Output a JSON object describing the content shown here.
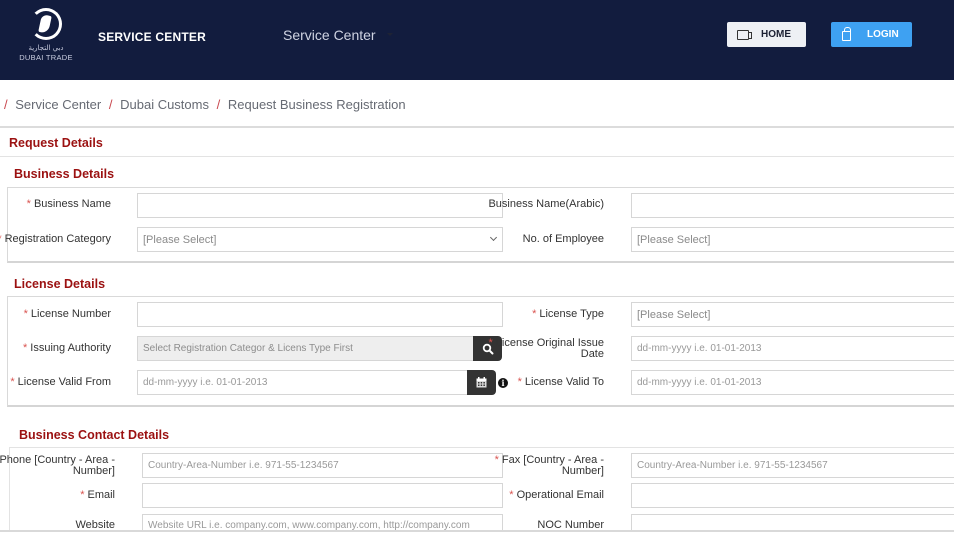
{
  "header": {
    "logo_arabic": "دبي التجارية",
    "logo_text": "DUBAI TRADE",
    "brand_title": "SERVICE CENTER",
    "nav_dropdown": "Service Center",
    "home_button": "HOME",
    "login_button": "LOGIN",
    "bg_color": "#121c3e",
    "login_color": "#3ea1f2"
  },
  "breadcrumb": {
    "items": [
      "Service Center",
      "Dubai Customs",
      "Request Business Registration"
    ],
    "separator": "/"
  },
  "page": {
    "title": "Request Details",
    "accent_color": "#9b1111"
  },
  "business_details": {
    "title": "Business Details",
    "business_name": {
      "label": "Business Name",
      "required": true,
      "value": ""
    },
    "business_name_arabic": {
      "label": "Business Name(Arabic)",
      "required": false,
      "value": ""
    },
    "registration_category": {
      "label": "Registration Category",
      "required": true,
      "selected": "[Please Select]"
    },
    "no_of_employee": {
      "label": "No. of Employee",
      "required": false,
      "selected": "[Please Select]"
    }
  },
  "license_details": {
    "title": "License Details",
    "license_number": {
      "label": "License Number",
      "required": true,
      "value": ""
    },
    "license_type": {
      "label": "License Type",
      "required": true,
      "selected": "[Please Select]"
    },
    "issuing_authority": {
      "label": "Issuing Authority",
      "required": true,
      "placeholder": "Select Registration Categor & Licens Type First"
    },
    "license_original_issue_date": {
      "label_line1": "License Original Issue",
      "label_line2": "Date",
      "required": true,
      "placeholder": "dd-mm-yyyy i.e. 01-01-2013"
    },
    "license_valid_from": {
      "label": "License Valid From",
      "required": true,
      "placeholder": "dd-mm-yyyy i.e. 01-01-2013"
    },
    "license_valid_to": {
      "label": "License Valid To",
      "required": true,
      "placeholder": "dd-mm-yyyy i.e. 01-01-2013"
    }
  },
  "business_contact_details": {
    "title": "Business Contact Details",
    "phone": {
      "label_line1": "Phone [Country - Area -",
      "label_line2": "Number]",
      "required": true,
      "placeholder": "Country-Area-Number i.e. 971-55-1234567"
    },
    "fax": {
      "label_line1": "Fax [Country - Area -",
      "label_line2": "Number]",
      "required": true,
      "placeholder": "Country-Area-Number i.e. 971-55-1234567"
    },
    "email": {
      "label": "Email",
      "required": true,
      "value": ""
    },
    "operational_email": {
      "label": "Operational Email",
      "required": true,
      "value": ""
    },
    "website": {
      "label": "Website",
      "required": false,
      "placeholder": "Website URL i.e. company.com, www.company.com, http://company.com"
    },
    "noc_number": {
      "label": "NOC Number",
      "required": false,
      "value": ""
    }
  },
  "icons": {
    "required_marker": "*",
    "info": "i"
  }
}
